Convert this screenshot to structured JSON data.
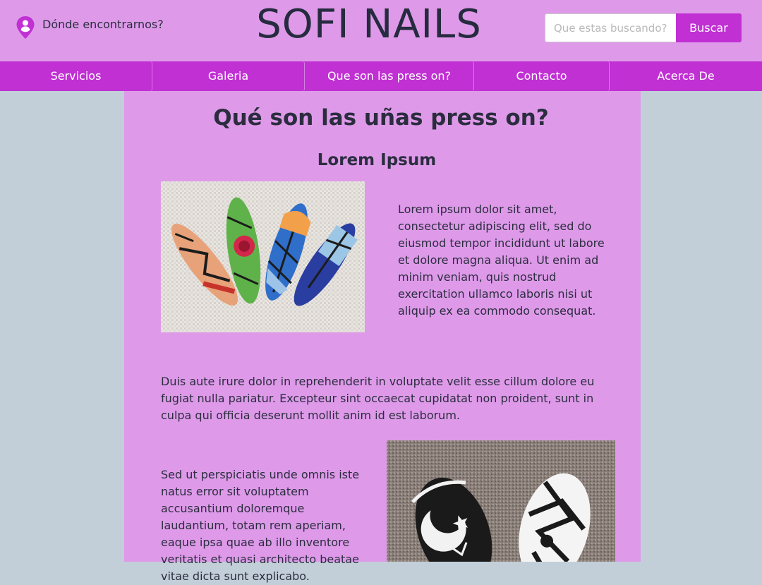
{
  "header": {
    "location_label": "Dónde encontrarnos?",
    "brand": "SOFI NAILS",
    "search": {
      "placeholder": "Que estas buscando?",
      "button_label": "Buscar"
    }
  },
  "nav": {
    "items": [
      {
        "label": "Servicios"
      },
      {
        "label": "Galeria"
      },
      {
        "label": "Que son las press on?"
      },
      {
        "label": "Contacto"
      },
      {
        "label": "Acerca De"
      }
    ]
  },
  "content": {
    "title": "Qué son las uñas press on?",
    "subtitle": "Lorem Ipsum",
    "paragraph_1": "Lorem ipsum dolor sit amet, consectetur adipiscing elit, sed do eiusmod  tempor incididunt ut labore et dolore magna aliqua. Ut enim ad minim  veniam, quis nostrud exercitation ullamco laboris nisi ut aliquip ex ea  commodo consequat.",
    "paragraph_2": "Duis aute irure dolor in reprehenderit in voluptate velit esse cillum  dolore eu fugiat nulla pariatur. Excepteur sint occaecat cupidatat non  proident, sunt in culpa qui officia deserunt mollit anim id est laborum.",
    "paragraph_3": "Sed ut perspiciatis unde omnis iste natus error sit voluptatem accusantium doloremque laudantium, totam rem aperiam, eaque ipsa quae ab  illo inventore veritatis et quasi architecto beatae vitae dicta sunt explicabo."
  },
  "colors": {
    "header_bg": "#de9ae9",
    "accent": "#c030d3",
    "page_bg": "#c3cfd8",
    "text": "#2b2d3f"
  },
  "icons": {
    "location": "location-pin-icon"
  }
}
